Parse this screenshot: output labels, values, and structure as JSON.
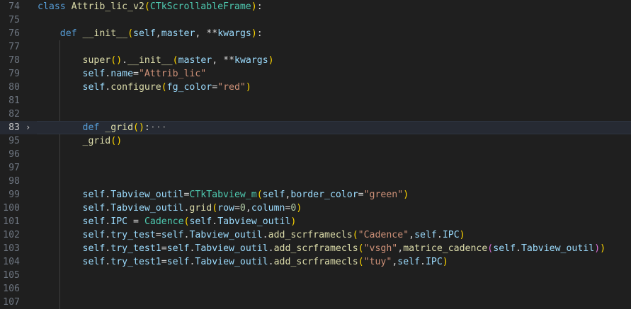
{
  "editor": {
    "current_line": "83",
    "lines": [
      {
        "n": "74",
        "t": "class Attrib_lic_v2(CTkScrollableFrame):"
      },
      {
        "n": "75",
        "t": ""
      },
      {
        "n": "76",
        "t": "    def __init__(self,master, **kwargs):"
      },
      {
        "n": "77",
        "t": ""
      },
      {
        "n": "78",
        "t": "        super().__init__(master, **kwargs)"
      },
      {
        "n": "79",
        "t": "        self.name=\"Attrib_lic\""
      },
      {
        "n": "80",
        "t": "        self.configure(fg_color=\"red\")"
      },
      {
        "n": "81",
        "t": ""
      },
      {
        "n": "82",
        "t": ""
      },
      {
        "n": "83",
        "t": "        def _grid():···"
      },
      {
        "n": "95",
        "t": "        _grid()"
      },
      {
        "n": "96",
        "t": ""
      },
      {
        "n": "97",
        "t": ""
      },
      {
        "n": "98",
        "t": ""
      },
      {
        "n": "99",
        "t": "        self.Tabview_outil=CTkTabview_m(self,border_color=\"green\")"
      },
      {
        "n": "100",
        "t": "        self.Tabview_outil.grid(row=0,column=0)"
      },
      {
        "n": "101",
        "t": "        self.IPC = Cadence(self.Tabview_outil)"
      },
      {
        "n": "102",
        "t": "        self.try_test=self.Tabview_outil.add_scrframecls(\"Cadence\",self.IPC)"
      },
      {
        "n": "103",
        "t": "        self.try_test1=self.Tabview_outil.add_scrframecls(\"vsgh\",matrice_cadence(self.Tabview_outil))"
      },
      {
        "n": "104",
        "t": "        self.try_test1=self.Tabview_outil.add_scrframecls(\"tuy\",self.IPC)"
      },
      {
        "n": "105",
        "t": ""
      },
      {
        "n": "106",
        "t": ""
      },
      {
        "n": "107",
        "t": ""
      }
    ],
    "fold_icon": "chevron-right-icon",
    "fold_line": "83",
    "colors": {
      "background": "#1f1f1f",
      "keyword": "#569cd6",
      "class": "#4ec9b0",
      "function": "#dcdcaa",
      "variable": "#9cdcfe",
      "string": "#ce9178",
      "number": "#b5cea8"
    }
  }
}
